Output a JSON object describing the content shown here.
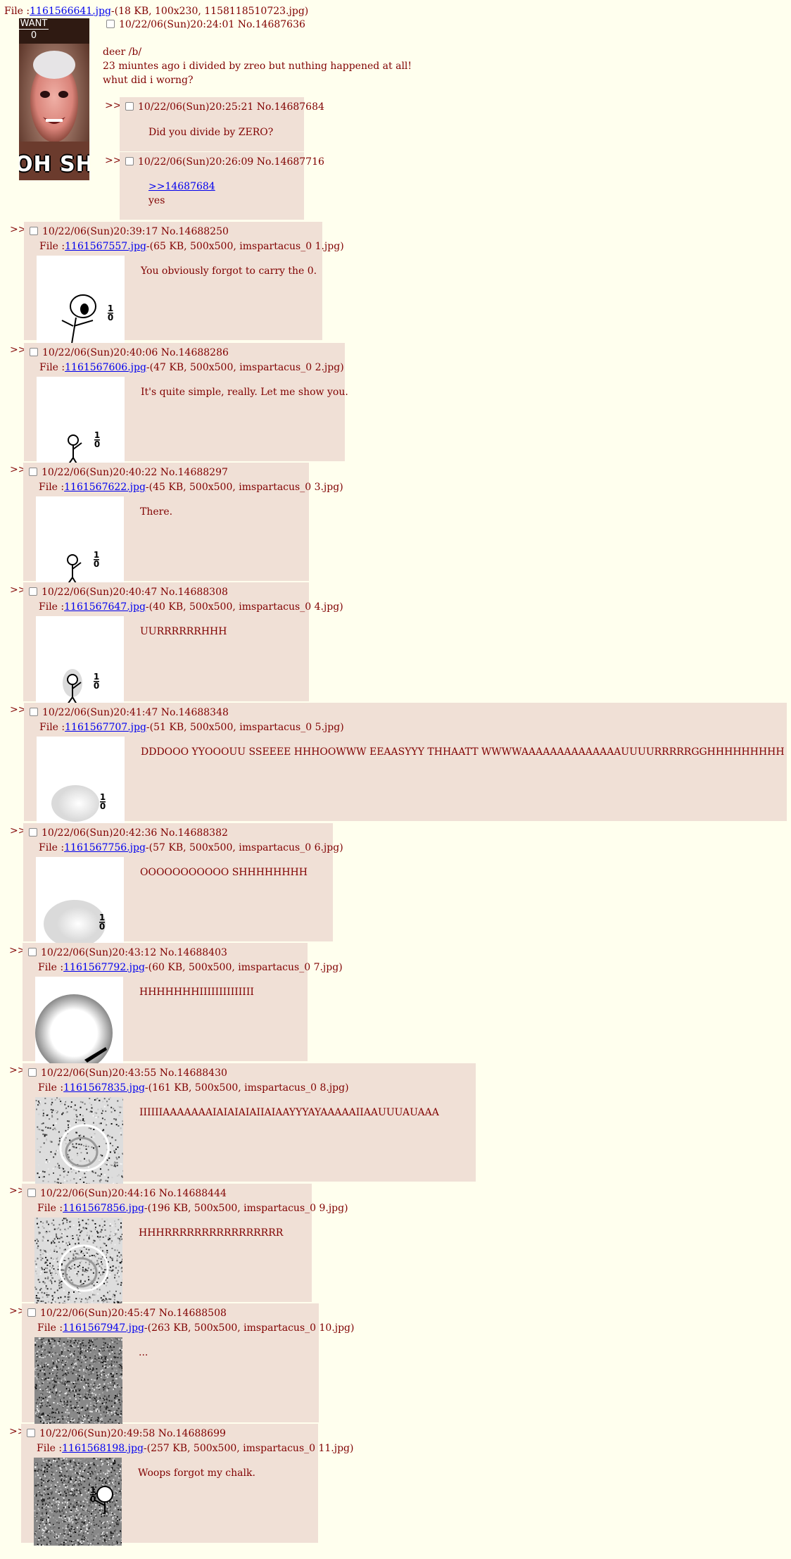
{
  "op": {
    "file_prefix": "File :",
    "file_link": "1161566641.jpg",
    "file_info": "-(18 KB, 100x230, 1158118510723.jpg)",
    "thumb_top_text": "WANT",
    "thumb_count": "0",
    "thumb_bottom_text": "OH  SHI",
    "date": "10/22/06(Sun)20:24:01",
    "no": "No.14687636",
    "message_lines": [
      "deer /b/",
      "23 miuntes ago i divided by zreo but nuthing happened at all!",
      "whut did i worng?"
    ]
  },
  "arrow_glyph": ">>",
  "file_prefix": "File :",
  "small_replies": [
    {
      "date": "10/22/06(Sun)20:25:21",
      "no": "No.14687684",
      "message": "Did you divide by ZERO?"
    },
    {
      "date": "10/22/06(Sun)20:26:09",
      "no": "No.14687716",
      "quote_link": ">>14687684",
      "message": "yes"
    }
  ],
  "replies": [
    {
      "date": "10/22/06(Sun)20:39:17",
      "no": "No.14688250",
      "file_link": "1161567557.jpg",
      "file_info": "-(65 KB, 500x500, imspartacus_0 1.jpg)",
      "message": "You obviously forgot to carry the 0."
    },
    {
      "date": "10/22/06(Sun)20:40:06",
      "no": "No.14688286",
      "file_link": "1161567606.jpg",
      "file_info": "-(47 KB, 500x500, imspartacus_0 2.jpg)",
      "message": "It's quite simple, really. Let me show you."
    },
    {
      "date": "10/22/06(Sun)20:40:22",
      "no": "No.14688297",
      "file_link": "1161567622.jpg",
      "file_info": "-(45 KB, 500x500, imspartacus_0 3.jpg)",
      "message": "There."
    },
    {
      "date": "10/22/06(Sun)20:40:47",
      "no": "No.14688308",
      "file_link": "1161567647.jpg",
      "file_info": "-(40 KB, 500x500, imspartacus_0 4.jpg)",
      "message": "UURRRRRRHHH"
    },
    {
      "date": "10/22/06(Sun)20:41:47",
      "no": "No.14688348",
      "file_link": "1161567707.jpg",
      "file_info": "-(51 KB, 500x500, imspartacus_0 5.jpg)",
      "message": "DDDOOO YYOOOUU SSEEEE HHHOOWWW EEAASYYY THHAATT WWWWAAAAAAAAAAAAAAUUUURRRRRGGHHHHHHHHH"
    },
    {
      "date": "10/22/06(Sun)20:42:36",
      "no": "No.14688382",
      "file_link": "1161567756.jpg",
      "file_info": "-(57 KB, 500x500, imspartacus_0 6.jpg)",
      "message": "OOOOOOOOOOO SHHHHHHHH"
    },
    {
      "date": "10/22/06(Sun)20:43:12",
      "no": "No.14688403",
      "file_link": "1161567792.jpg",
      "file_info": "-(60 KB, 500x500, imspartacus_0 7.jpg)",
      "message": "HHHHHHHIIIIIIIIIIIIII"
    },
    {
      "date": "10/22/06(Sun)20:43:55",
      "no": "No.14688430",
      "file_link": "1161567835.jpg",
      "file_info": "-(161 KB, 500x500, imspartacus_0 8.jpg)",
      "message": "IIIIIIAAAAAAAIAIAIAIAIIAIAAYYYAYAAAAAIIAAUUUAUAAA"
    },
    {
      "date": "10/22/06(Sun)20:44:16",
      "no": "No.14688444",
      "file_link": "1161567856.jpg",
      "file_info": "-(196 KB, 500x500, imspartacus_0 9.jpg)",
      "message": "HHHRRRRRRRRRRRRRRRR"
    },
    {
      "date": "10/22/06(Sun)20:45:47",
      "no": "No.14688508",
      "file_link": "1161567947.jpg",
      "file_info": "-(263 KB, 500x500, imspartacus_0 10.jpg)",
      "message": "..."
    },
    {
      "date": "10/22/06(Sun)20:49:58",
      "no": "No.14688699",
      "file_link": "1161568198.jpg",
      "file_info": "-(257 KB, 500x500, imspartacus_0 11.jpg)",
      "message": "Woops forgot my chalk."
    }
  ]
}
